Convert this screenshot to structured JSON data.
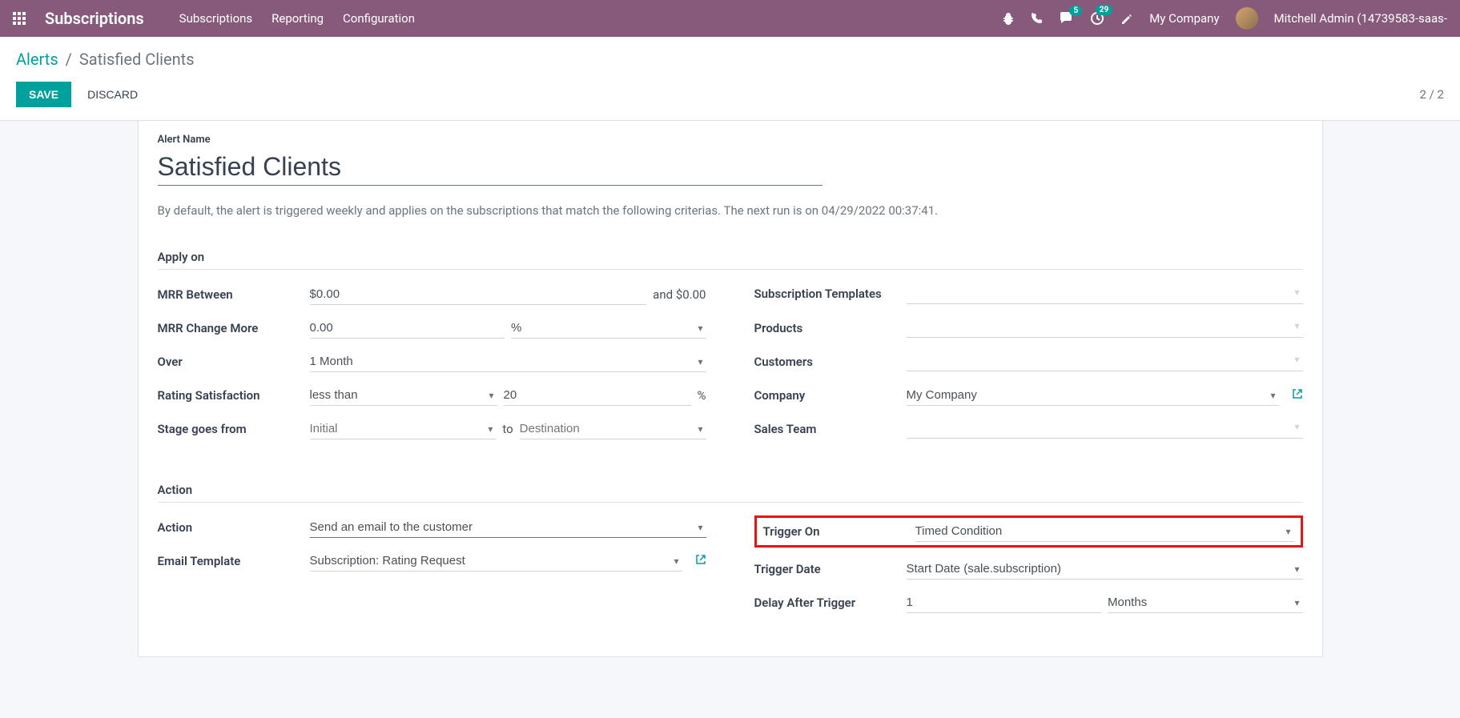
{
  "navbar": {
    "brand": "Subscriptions",
    "menu": [
      "Subscriptions",
      "Reporting",
      "Configuration"
    ],
    "messages_badge": "5",
    "activities_badge": "29",
    "company": "My Company",
    "user": "Mitchell Admin (14739583-saas-"
  },
  "breadcrumb": {
    "parent": "Alerts",
    "current": "Satisfied Clients"
  },
  "actions": {
    "save": "SAVE",
    "discard": "DISCARD",
    "pager": "2 / 2"
  },
  "form": {
    "alert_name_label": "Alert Name",
    "alert_name": "Satisfied Clients",
    "help_text": "By default, the alert is triggered weekly and applies on the subscriptions that match the following criterias. The next run is on 04/29/2022 00:37:41.",
    "section_apply_on": "Apply on",
    "section_action": "Action",
    "mrr_between_label": "MRR Between",
    "mrr_between_from": "$0.00",
    "mrr_between_and": "and",
    "mrr_between_to": "$0.00",
    "mrr_change_label": "MRR Change More",
    "mrr_change_value": "0.00",
    "mrr_change_unit": "%",
    "over_label": "Over",
    "over_value": "1 Month",
    "rating_label": "Rating Satisfaction",
    "rating_op": "less than",
    "rating_value": "20",
    "rating_suffix": "%",
    "stage_label": "Stage goes from",
    "stage_from_placeholder": "Initial",
    "stage_to_text": "to",
    "stage_to_placeholder": "Destination",
    "sub_templates_label": "Subscription Templates",
    "products_label": "Products",
    "customers_label": "Customers",
    "company_label": "Company",
    "company_value": "My Company",
    "sales_team_label": "Sales Team",
    "action_label": "Action",
    "action_value": "Send an email to the customer",
    "email_template_label": "Email Template",
    "email_template_value": "Subscription: Rating Request",
    "trigger_on_label": "Trigger On",
    "trigger_on_value": "Timed Condition",
    "trigger_date_label": "Trigger Date",
    "trigger_date_value": "Start Date (sale.subscription)",
    "delay_label": "Delay After Trigger",
    "delay_value": "1",
    "delay_unit": "Months"
  }
}
